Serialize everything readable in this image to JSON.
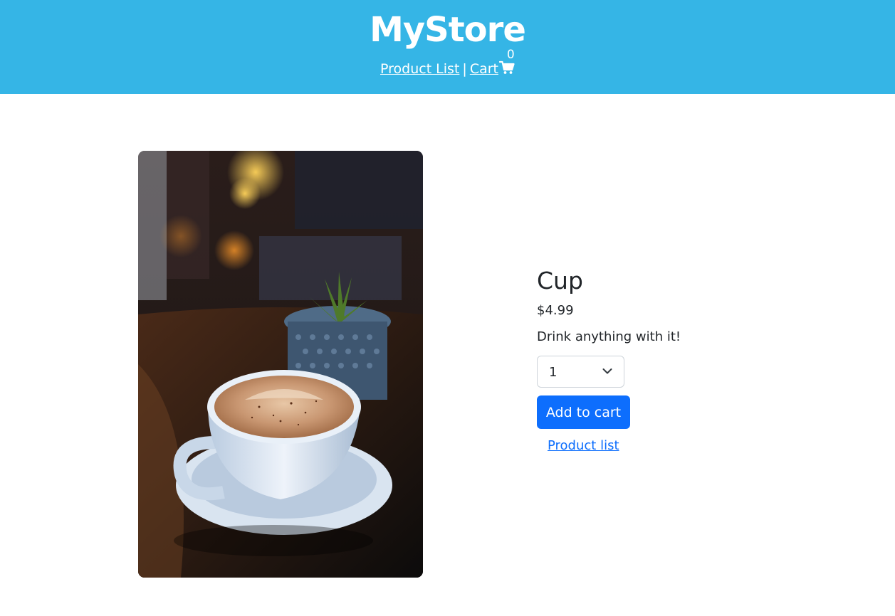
{
  "header": {
    "brand": "MyStore",
    "nav": {
      "product_list": "Product List",
      "separator": "|",
      "cart": "Cart",
      "cart_count": "0",
      "cart_icon": "shopping-cart-icon"
    }
  },
  "product": {
    "name": "Cup",
    "price": "$4.99",
    "description": "Drink anything with it!",
    "image_alt": "coffee-cup-photo",
    "quantity": {
      "selected": "1"
    },
    "add_to_cart_label": "Add to cart",
    "back_link_label": "Product list"
  },
  "colors": {
    "header_bg": "#35b5e6",
    "primary": "#0d6efd",
    "text": "#212529"
  }
}
